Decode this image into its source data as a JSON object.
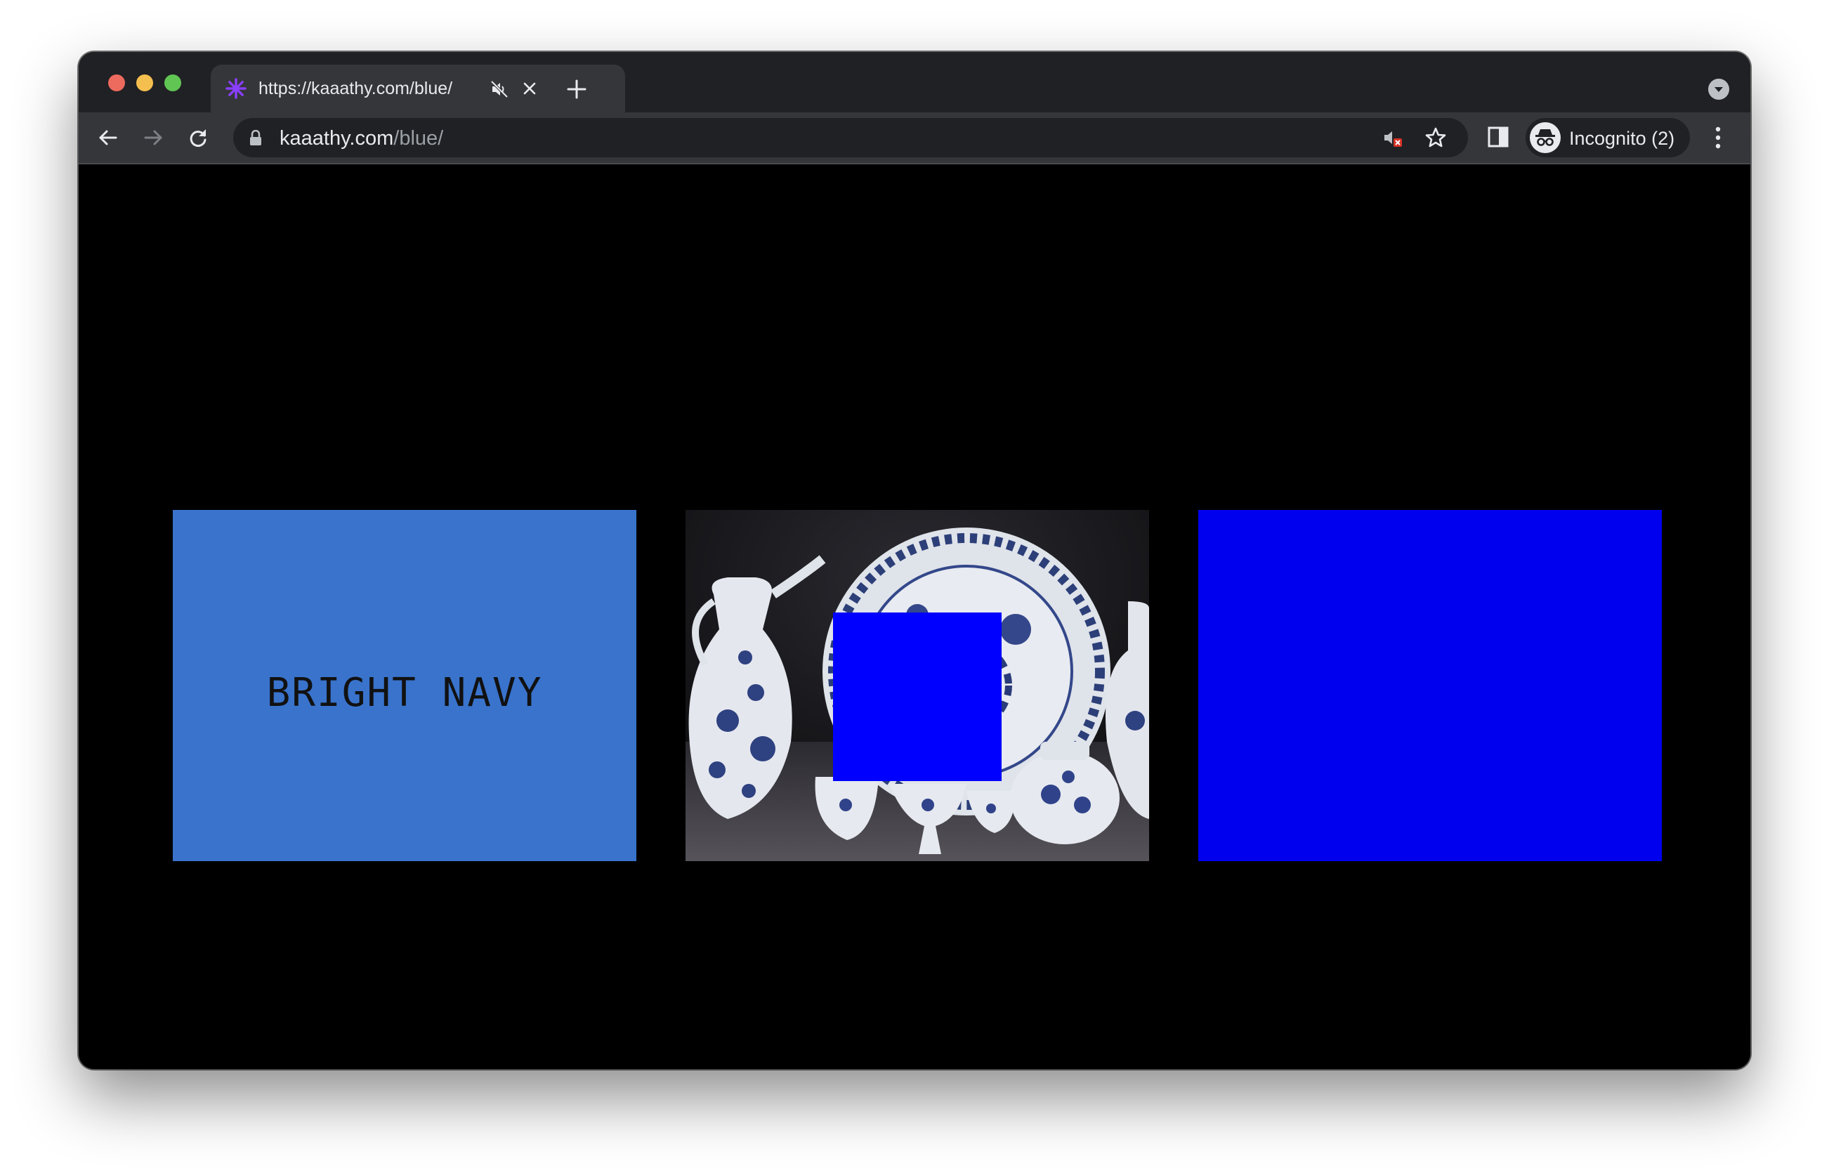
{
  "browser": {
    "tab": {
      "title": "https://kaaathy.com/blue/",
      "favicon": "asterisk-favicon-icon",
      "favicon_color": "#8a3ffc"
    },
    "address": {
      "host": "kaaathy.com",
      "path": "/blue/"
    },
    "profile": {
      "label": "Incognito (2)",
      "icon": "incognito-icon"
    },
    "icons": {
      "back": "arrow-left-icon",
      "forward": "arrow-right-icon",
      "reload": "reload-icon",
      "lock": "lock-icon",
      "sound_blocked": "sound-blocked-icon",
      "bookmark": "star-icon",
      "side_panel": "side-panel-icon",
      "menu": "more-vertical-icon",
      "mute": "muted-speaker-icon",
      "close_tab": "close-icon",
      "new_tab": "plus-icon",
      "tab_search": "chevron-down-icon"
    },
    "colors": {
      "frame": "#202124",
      "toolbar": "#35363a"
    }
  },
  "page": {
    "background": "#000000",
    "cards": [
      {
        "kind": "swatch",
        "label": "BRIGHT NAVY",
        "color": "#3973cc"
      },
      {
        "kind": "image",
        "description_icon": "porcelain-photo",
        "overlay_color": "#0000ff"
      },
      {
        "kind": "swatch",
        "label": "",
        "color": "#0000ee"
      }
    ]
  }
}
